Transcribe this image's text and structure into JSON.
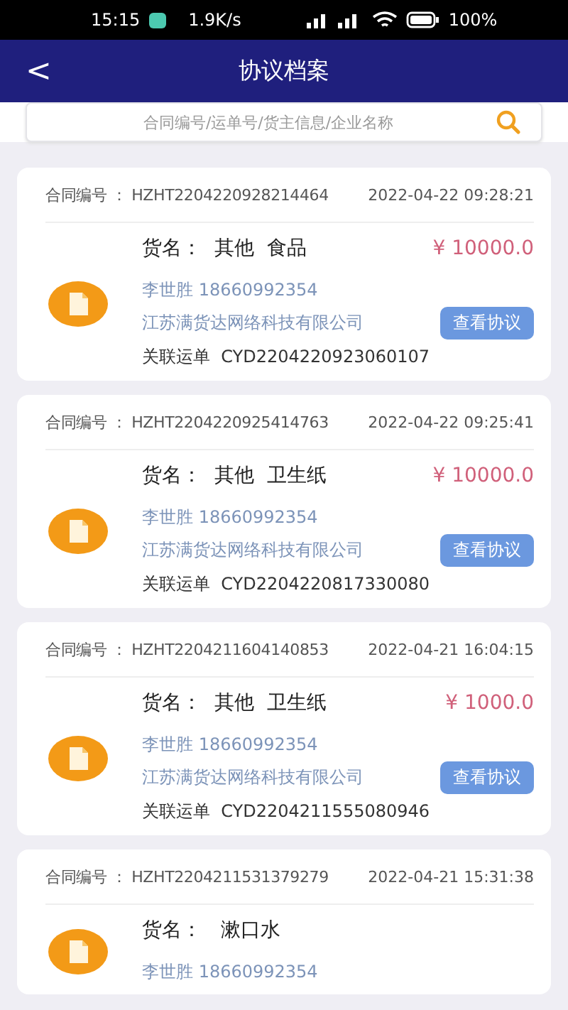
{
  "status_bar": {
    "time": "15:15",
    "speed": "1.9K/s",
    "battery": "100%"
  },
  "nav": {
    "back": "<",
    "title": "协议档案"
  },
  "search": {
    "placeholder": "合同编号/运单号/货主信息/企业名称"
  },
  "cards": [
    {
      "contract_label": "合同编号 ： HZHT2204220928214464",
      "time": "2022-04-22 09:28:21",
      "goods": "货名：  其他  食品",
      "price": "¥ 10000.0",
      "contact": "李世胜 18660992354",
      "company": "江苏满货达网络科技有限公司",
      "button": "查看协议",
      "waybill": "关联运单  CYD2204220923060107"
    },
    {
      "contract_label": "合同编号 ： HZHT2204220925414763",
      "time": "2022-04-22 09:25:41",
      "goods": "货名：  其他  卫生纸",
      "price": "¥ 10000.0",
      "contact": "李世胜 18660992354",
      "company": "江苏满货达网络科技有限公司",
      "button": "查看协议",
      "waybill": "关联运单  CYD2204220817330080"
    },
    {
      "contract_label": "合同编号 ： HZHT2204211604140853",
      "time": "2022-04-21 16:04:15",
      "goods": "货名：  其他  卫生纸",
      "price": "¥ 1000.0",
      "contact": "李世胜 18660992354",
      "company": "江苏满货达网络科技有限公司",
      "button": "查看协议",
      "waybill": "关联运单  CYD2204211555080946"
    },
    {
      "contract_label": "合同编号 ： HZHT2204211531379279",
      "time": "2022-04-21 15:31:38",
      "goods": "货名：   漱口水",
      "contact": "李世胜 18660992354"
    }
  ]
}
